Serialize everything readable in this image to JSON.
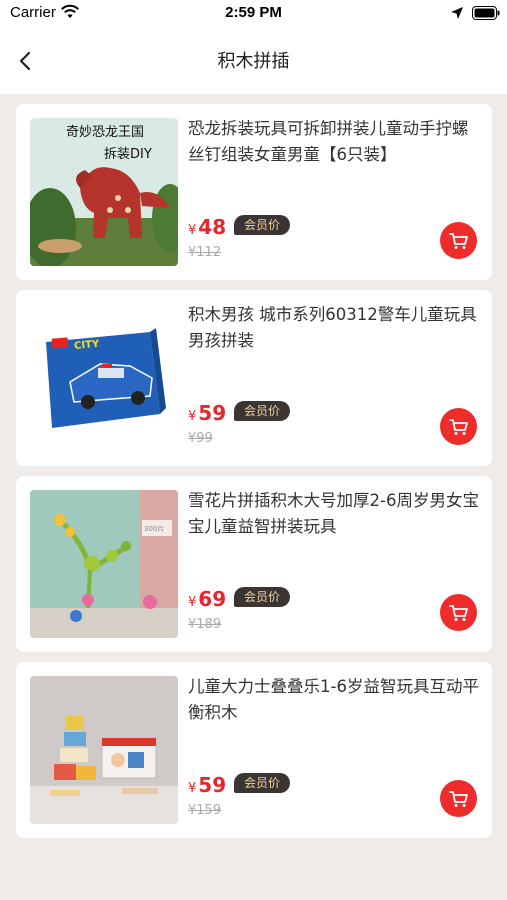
{
  "status_bar": {
    "carrier": "Carrier",
    "time": "2:59 PM"
  },
  "nav": {
    "title": "积木拼插"
  },
  "products": [
    {
      "title": "恐龙拆装玩具可拆卸拼装儿童动手拧螺丝钉组装女童男童【6只装】",
      "currency": "¥",
      "price": "48",
      "badge": "会员价",
      "original_price": "¥112",
      "image_caption_1": "奇妙恐龙王国",
      "image_caption_2": "拆装DIY"
    },
    {
      "title": "积木男孩 城市系列60312警车儿童玩具男孩拼装",
      "currency": "¥",
      "price": "59",
      "badge": "会员价",
      "original_price": "¥99",
      "image_caption_1": "CITY"
    },
    {
      "title": "雪花片拼插积木大号加厚2-6周岁男女宝宝儿童益智拼装玩具",
      "currency": "¥",
      "price": "69",
      "badge": "会员价",
      "original_price": "¥189",
      "image_caption_1": "300片"
    },
    {
      "title": "儿童大力士叠叠乐1-6岁益智玩具互动平衡积木",
      "currency": "¥",
      "price": "59",
      "badge": "会员价",
      "original_price": "¥159"
    }
  ],
  "colors": {
    "price": "#e6262b",
    "cart": "#ee2c2c",
    "badge_bg": "#3a3533",
    "badge_text": "#f1cf9b"
  }
}
